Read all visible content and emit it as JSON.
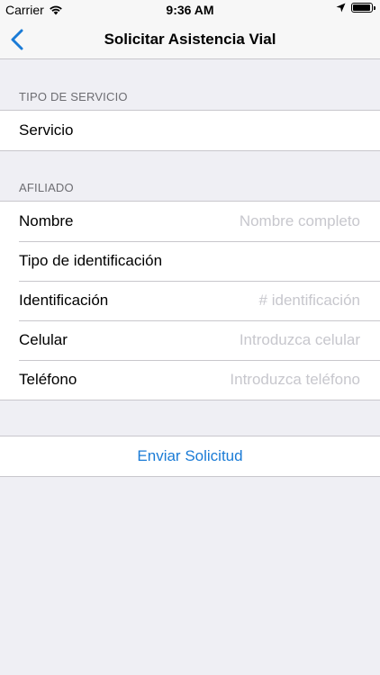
{
  "status_bar": {
    "carrier": "Carrier",
    "time": "9:36 AM",
    "battery_level": 0.95
  },
  "nav": {
    "title": "Solicitar Asistencia Vial",
    "back_icon": "chevron-left-icon"
  },
  "sections": {
    "service": {
      "header": "TIPO DE SERVICIO",
      "row_label": "Servicio"
    },
    "affiliate": {
      "header": "AFILIADO",
      "rows": [
        {
          "label": "Nombre",
          "placeholder": "Nombre completo"
        },
        {
          "label": "Tipo de identificación"
        },
        {
          "label": "Identificación",
          "placeholder": "# identificación"
        },
        {
          "label": "Celular",
          "placeholder": "Introduzca celular"
        },
        {
          "label": "Teléfono",
          "placeholder": "Introduzca teléfono"
        }
      ]
    }
  },
  "submit": {
    "label": "Enviar Solicitud"
  },
  "colors": {
    "accent": "#1a7bd6",
    "background": "#efeff4",
    "separator": "#c8c7cc",
    "placeholder": "#c7c7cd"
  }
}
